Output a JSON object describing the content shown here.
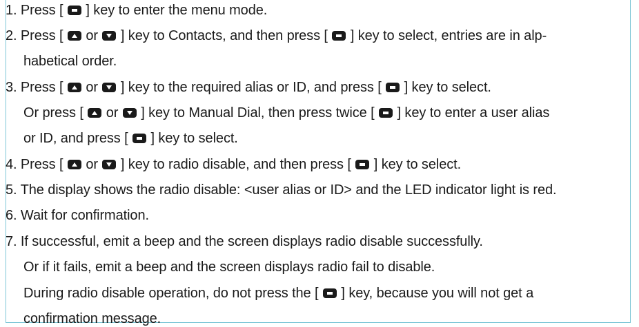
{
  "steps": [
    {
      "p1": "1. Press [ ",
      "p2": " ] key to enter the menu mode."
    },
    {
      "p1": "2. Press [ ",
      "p2": " or ",
      "p3": " ] key to Contacts, and then press [ ",
      "p4": " ] key to select, entries are in alp-"
    },
    {
      "p1": "habetical order."
    },
    {
      "p1": "3. Press [ ",
      "p2": " or ",
      "p3": " ] key to the required alias or ID, and press [ ",
      "p4": " ] key to select."
    },
    {
      "p1": "Or press [ ",
      "p2": " or ",
      "p3": " ] key to Manual Dial, then press twice [ ",
      "p4": " ] key to enter a user alias"
    },
    {
      "p1": "or ID, and press [ ",
      "p2": " ] key to select."
    },
    {
      "p1": "4. Press [ ",
      "p2": " or ",
      "p3": " ] key to radio disable, and then press [ ",
      "p4": " ] key to select."
    },
    {
      "p1": "5. The display shows the radio disable: <user alias or ID> and the LED indicator light is red."
    },
    {
      "p1": "6. Wait for confirmation."
    },
    {
      "p1": "7. If successful, emit a beep and the screen displays radio disable successfully."
    },
    {
      "p1": "Or if it fails, emit a beep and the screen displays radio fail to disable."
    },
    {
      "p1": "During radio disable operation, do not press the [ ",
      "p2": " ] key, because you will not get a"
    },
    {
      "p1": "confirmation message."
    }
  ]
}
